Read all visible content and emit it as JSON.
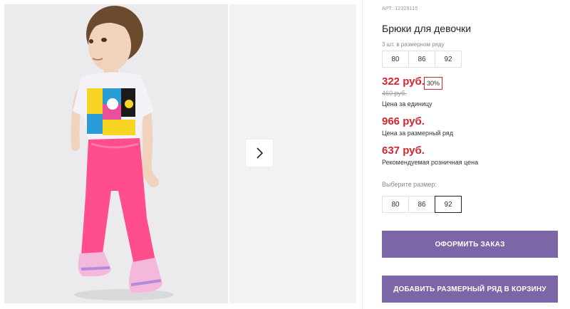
{
  "product": {
    "sku_label": "АРТ:",
    "sku": "12329115",
    "title": "Брюки для девочки"
  },
  "size_row": {
    "label": "3 шт. в размерном ряду",
    "sizes": [
      "80",
      "86",
      "92"
    ]
  },
  "pricing": {
    "unit_price": "322 руб.",
    "discount": "30%",
    "old_price": "460 руб.",
    "unit_caption": "Цена за единицу",
    "row_price": "966 руб.",
    "row_caption": "Цена за размерный ряд",
    "retail_price": "637 руб.",
    "retail_caption": "Рекомендуемая розничная цена"
  },
  "size_picker": {
    "label": "Выберите размер:",
    "sizes": [
      "80",
      "86",
      "92"
    ],
    "selected": "92"
  },
  "actions": {
    "order_label": "ОФОРМИТЬ ЗАКАЗ",
    "add_row_label": "ДОБАВИТЬ РАЗМЕРНЫЙ РЯД В КОРЗИНУ"
  },
  "colors": {
    "accent": "#7b67a8",
    "price": "#d6252e"
  },
  "icons": {
    "next": "chevron-right-icon"
  }
}
